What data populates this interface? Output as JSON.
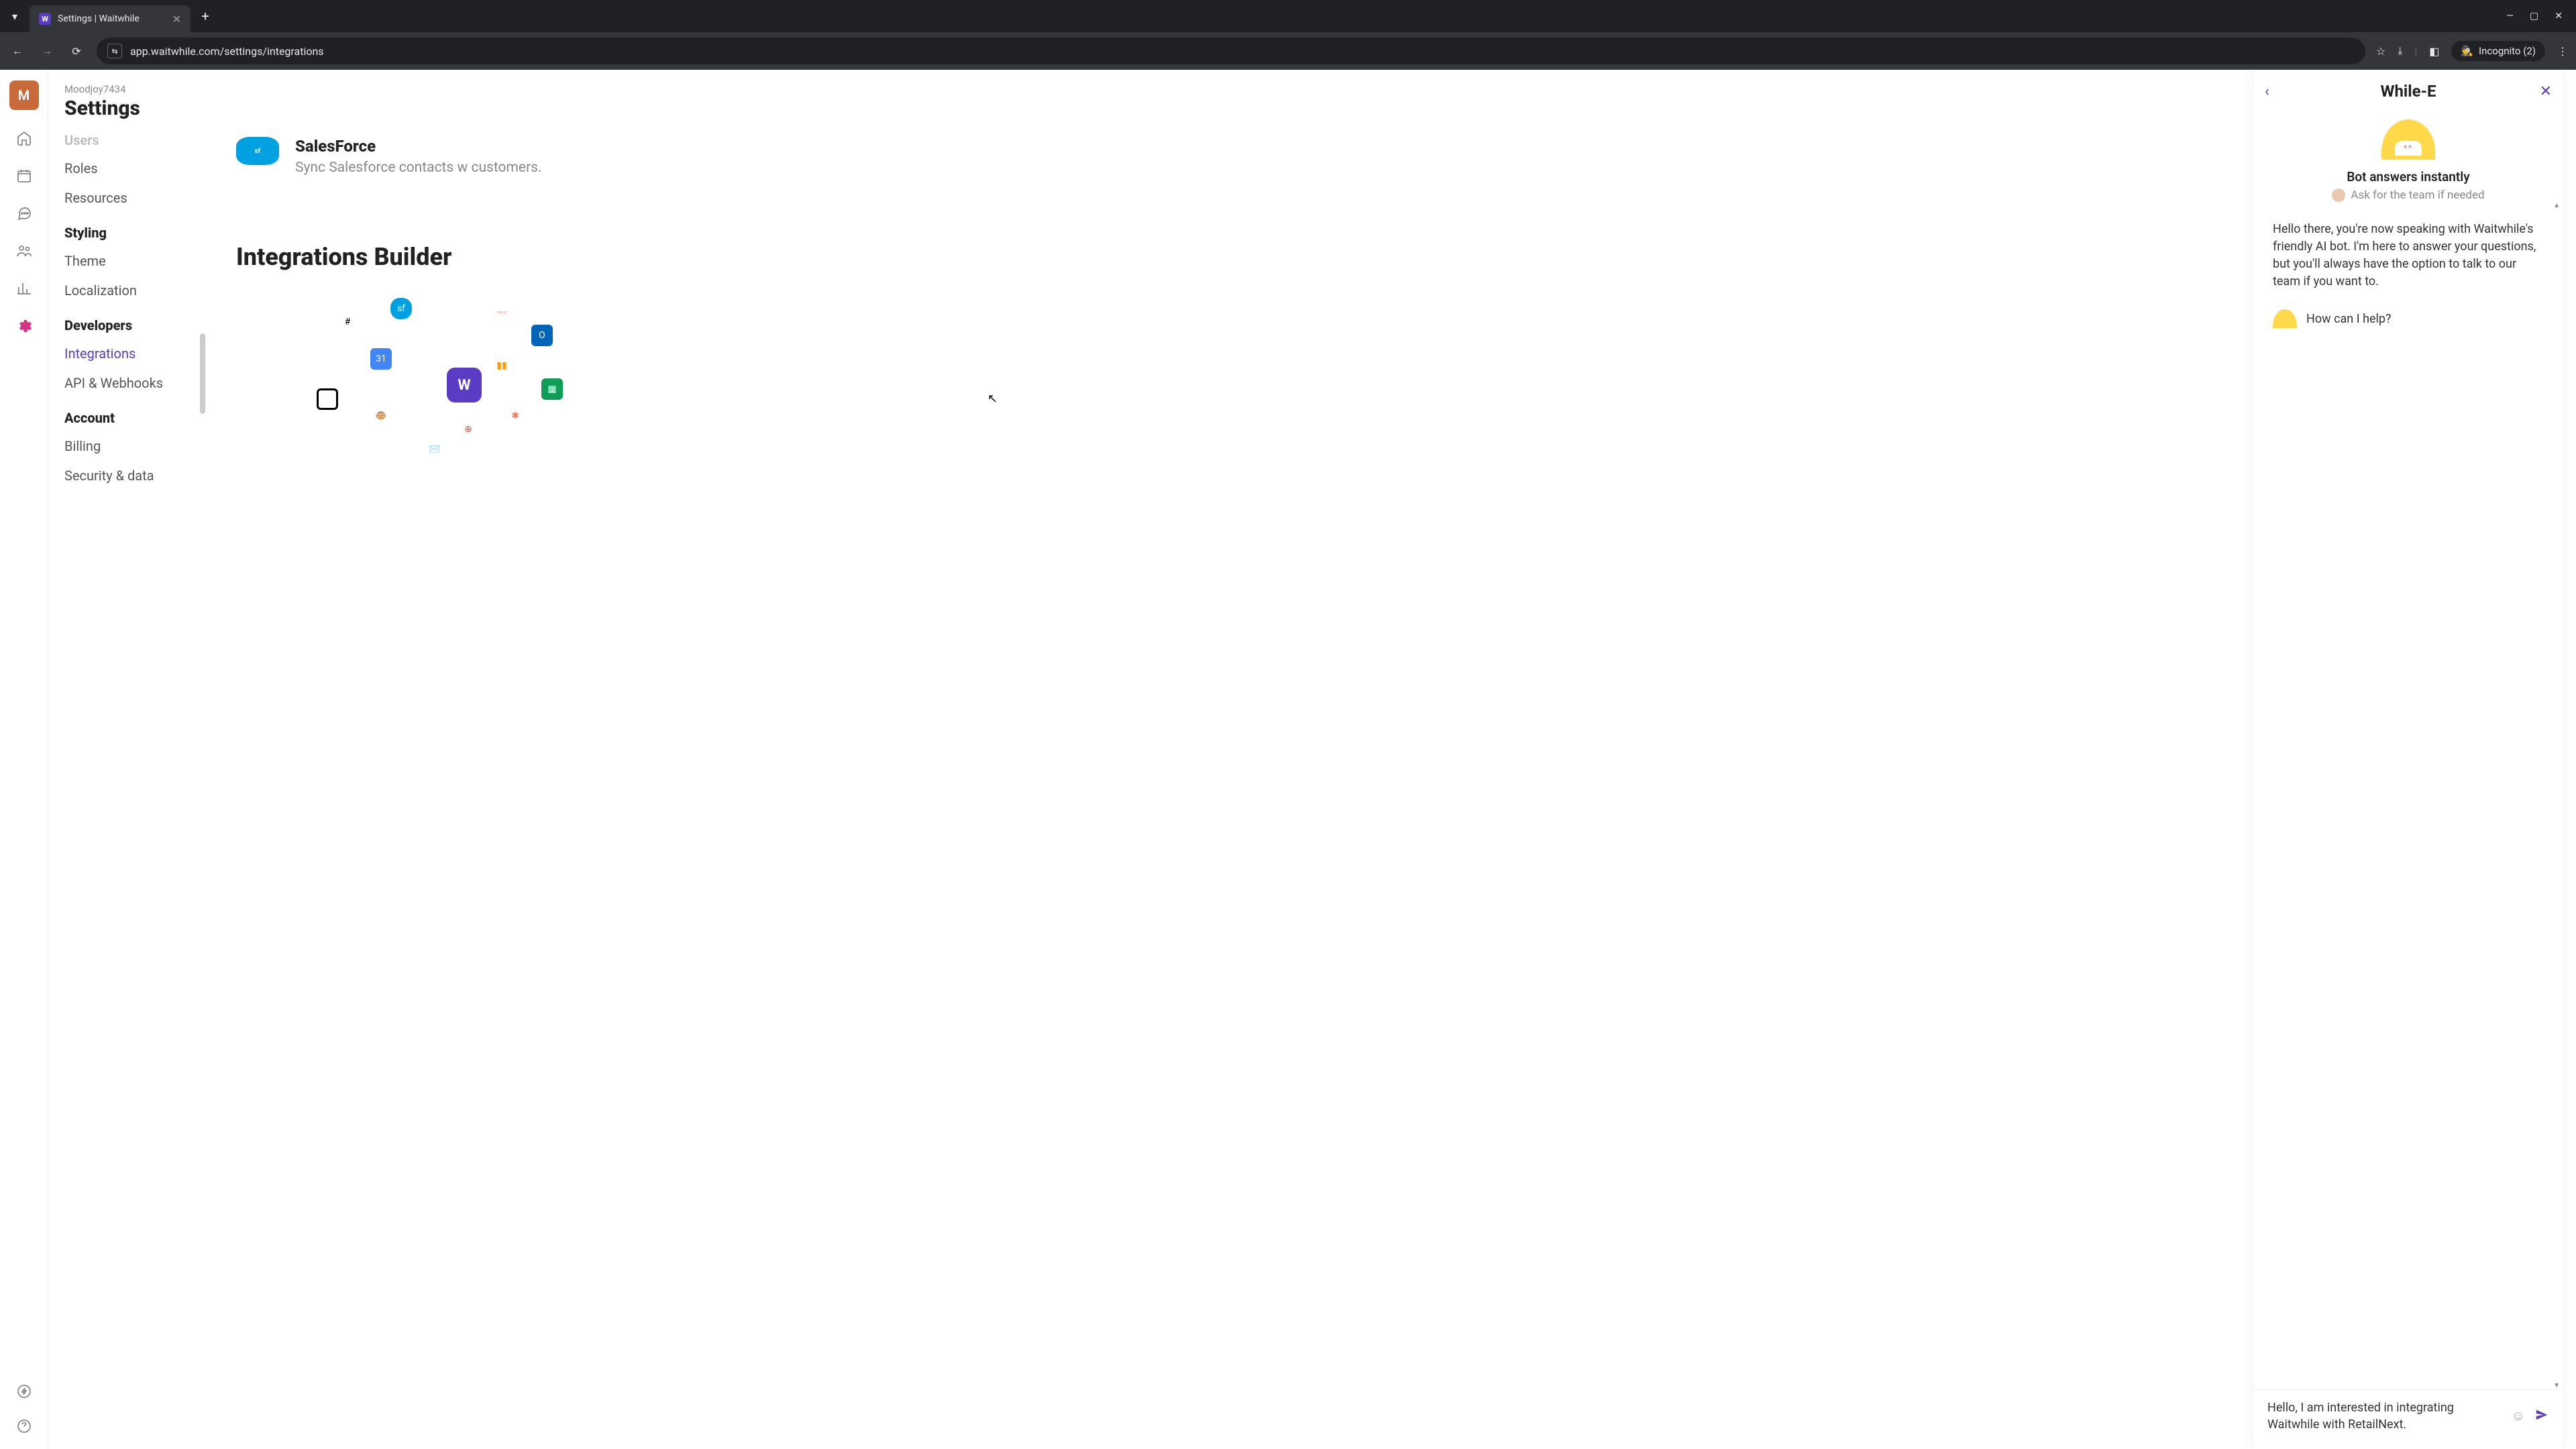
{
  "browser": {
    "tab_title": "Settings | Waitwhile",
    "url": "app.waitwhile.com/settings/integrations",
    "incognito_label": "Incognito (2)"
  },
  "org": {
    "avatar_initial": "M",
    "name": "Moodjoy7434"
  },
  "page": {
    "title": "Settings"
  },
  "sidebar": {
    "scroll_fade": "Users",
    "items": [
      {
        "label": "Roles"
      },
      {
        "label": "Resources"
      }
    ],
    "heading_styling": "Styling",
    "styling_items": [
      {
        "label": "Theme"
      },
      {
        "label": "Localization"
      }
    ],
    "heading_developers": "Developers",
    "dev_items": [
      {
        "label": "Integrations",
        "active": true
      },
      {
        "label": "API & Webhooks"
      }
    ],
    "heading_account": "Account",
    "account_items": [
      {
        "label": "Billing"
      },
      {
        "label": "Security & data"
      }
    ]
  },
  "integrations": {
    "salesforce": {
      "title": "SalesForce",
      "desc": "Sync Salesforce contacts w\ncustomers."
    },
    "builder_heading": "Integrations Builder"
  },
  "chat": {
    "title": "While-E",
    "sub1": "Bot answers instantly",
    "sub2": "Ask for the team if needed",
    "messages": [
      "Hello there, you're now speaking with Waitwhile's friendly AI bot. I'm here to answer your questions, but you'll always have the option to talk to our team if you want to.",
      "How can I help?"
    ],
    "input_value": "Hello, I am interested in integrating Waitwhile with RetailNext."
  },
  "colors": {
    "accent": "#5b3cc4",
    "org_avatar": "#c96a3a",
    "bot_yellow": "#ffd94a",
    "salesforce": "#00a1e0"
  }
}
